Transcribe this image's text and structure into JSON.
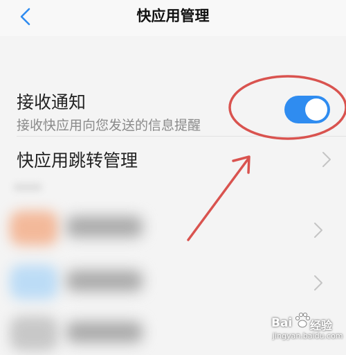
{
  "header": {
    "title": "快应用管理",
    "back_icon": "chevron-left-icon"
  },
  "notification": {
    "label": "接收通知",
    "description": "接收快应用向您发送的信息提醒",
    "toggle_on": true,
    "accent_color": "#2f8cf0"
  },
  "jump_management": {
    "label": "快应用跳转管理"
  },
  "blurred_items": [
    {
      "icon_color": "#f3b99a"
    },
    {
      "icon_color": "#bcdcf6"
    },
    {
      "icon_color": "#c8c8c8"
    }
  ],
  "annotation": {
    "color": "#d9534f"
  },
  "watermark": {
    "brand_latin": "Bai",
    "brand_suffix": "经验",
    "domain": "jingyan.baidu.com"
  }
}
